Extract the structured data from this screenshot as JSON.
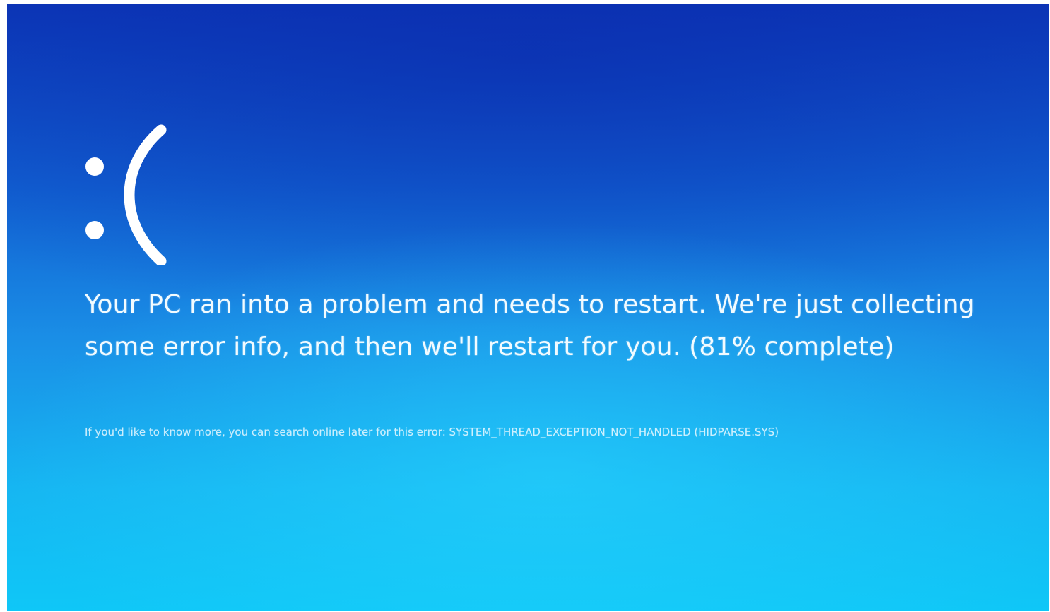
{
  "screen": {
    "frown_face": ":(",
    "message": "Your PC ran into a problem and needs to restart. We're just collecting some error info, and then we'll restart for you. (81% complete)",
    "progress_percent": 81,
    "details_line": "If you'd like to know more, you can search online later for this error: SYSTEM_THREAD_EXCEPTION_NOT_HANDLED (HIDPARSE.SYS)",
    "background_top_color": "#0c37b8",
    "background_bottom_color": "#0fc7f7",
    "text_color": "#ffffff"
  }
}
